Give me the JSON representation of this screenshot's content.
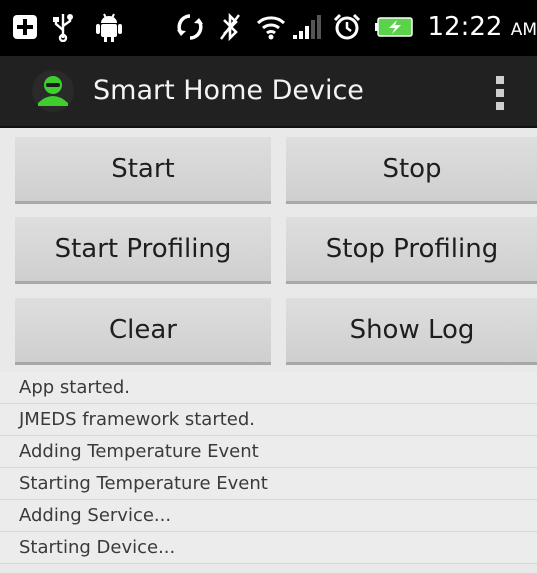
{
  "status_bar": {
    "time": "12:22",
    "ampm": "AM",
    "icons": [
      "add-notification-icon",
      "usb-icon",
      "android-debug-icon",
      "sync-icon",
      "bluetooth-off-icon",
      "wifi-icon",
      "signal-icon",
      "alarm-icon",
      "battery-charging-icon"
    ]
  },
  "action_bar": {
    "title": "Smart Home Device",
    "app_icon": "user-avatar-icon",
    "overflow_icon": "overflow-menu-icon"
  },
  "buttons": {
    "start": "Start",
    "stop": "Stop",
    "start_profiling": "Start Profiling",
    "stop_profiling": "Stop Profiling",
    "clear": "Clear",
    "show_log": "Show Log"
  },
  "log": [
    "App started.",
    "JMEDS framework started.",
    "Adding Temperature Event",
    "Starting Temperature Event",
    "Adding Service...",
    "Starting Device..."
  ],
  "colors": {
    "status_bar_bg": "#000000",
    "action_bar_bg": "#212121",
    "content_bg": "#e9e9e9",
    "button_bg": "#d6d6d6",
    "app_icon_green": "#3ecf2e",
    "battery_green": "#5ad34a"
  }
}
